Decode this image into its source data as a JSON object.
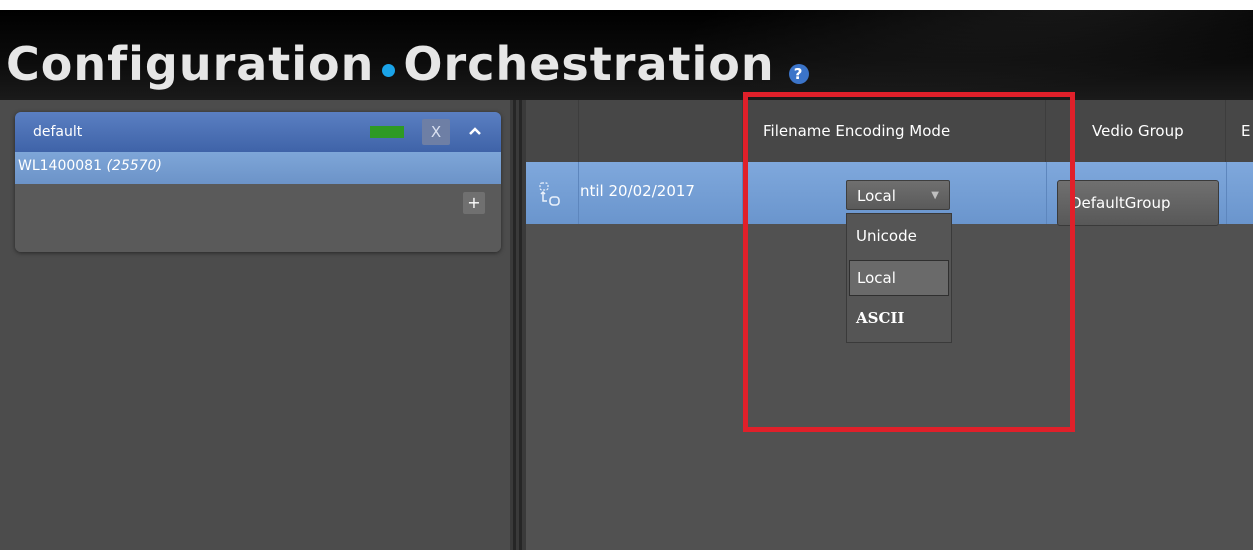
{
  "header": {
    "title_part1": "Configuration",
    "title_part2": "Orchestration",
    "help_icon": "?"
  },
  "left_panel": {
    "group": {
      "name": "default",
      "status_color": "#2e9a24",
      "remove_label": "X",
      "collapse_icon": "^",
      "server_id": "WL1400081",
      "server_count": "(25570)",
      "add_label": "+"
    }
  },
  "grid": {
    "columns": [
      "",
      "",
      "Filename Encoding Mode",
      "Vedio Group",
      "E"
    ],
    "row": {
      "date_text": "ntil 20/02/2017",
      "encoding_value": "Local",
      "group_value": "DefaultGroup"
    },
    "encoding_options": [
      "Unicode",
      "Local",
      "ASCII"
    ],
    "selected_option": "Local"
  },
  "colors": {
    "highlight": "#e0202a",
    "selection_row": "#7fa8dc",
    "accent_dot": "#1aa3e8"
  }
}
